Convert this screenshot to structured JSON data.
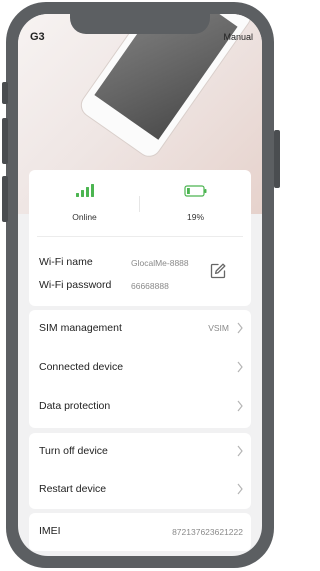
{
  "header": {
    "title": "G3",
    "manual_label": "Manual"
  },
  "status": {
    "signal": {
      "label": "Online",
      "bars": 4,
      "color": "#4cb551"
    },
    "battery": {
      "label": "19%",
      "level": 0.19,
      "color": "#4cb551"
    }
  },
  "wifi": {
    "name_label": "Wi-Fi name",
    "name_value": "GlocalMe-8888",
    "password_label": "Wi-Fi password",
    "password_value": "66668888",
    "edit_icon": "edit-icon"
  },
  "menu1": {
    "items": [
      {
        "label": "SIM management",
        "value": "VSIM"
      },
      {
        "label": "Connected device",
        "value": ""
      },
      {
        "label": "Data protection",
        "value": ""
      }
    ]
  },
  "menu2": {
    "items": [
      {
        "label": "Turn off device"
      },
      {
        "label": "Restart device"
      }
    ]
  },
  "imei": {
    "label": "IMEI",
    "value": "872137623621222"
  }
}
